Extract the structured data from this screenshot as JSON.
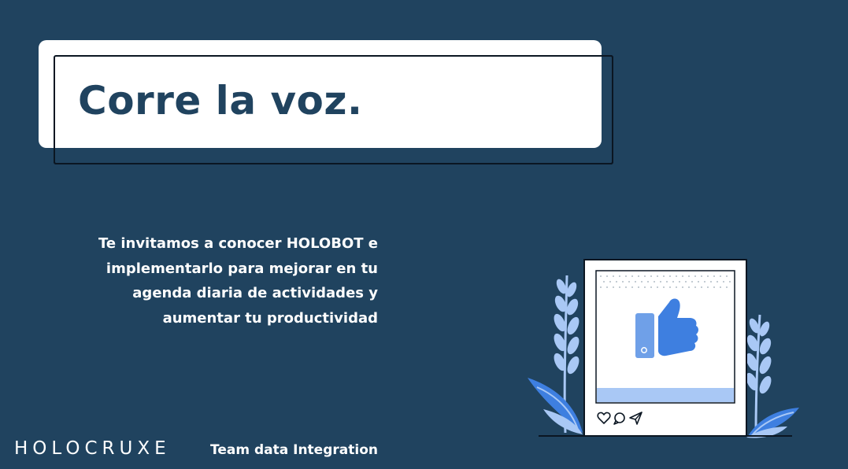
{
  "title": "Corre la voz.",
  "body_lines": [
    "Te invitamos a conocer HOLOBOT e",
    "implementarlo para mejorar en tu",
    "agenda diaria de actividades y",
    "aumentar tu productividad"
  ],
  "brand": "HOLOCRUXE",
  "team": "Team data Integration",
  "icons": {
    "thumbs_up": "thumbs-up-icon",
    "heart": "heart-icon",
    "comment": "comment-icon",
    "send": "send-icon"
  },
  "colors": {
    "background": "#20435F",
    "title_text": "#20435F",
    "card": "#FFFFFF",
    "accent_blue": "#3E7FE0",
    "light_blue": "#A9C8F5"
  }
}
